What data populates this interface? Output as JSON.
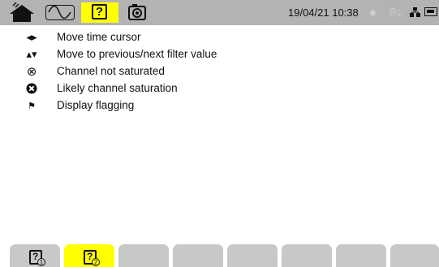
{
  "status_bar": {
    "datetime": "19/04/21 10:38",
    "icons": [
      "home-icon",
      "waveform-icon",
      "help-icon",
      "camera-icon",
      "recording-icon",
      "usb-icon",
      "network-icon",
      "battery-icon"
    ]
  },
  "legend": [
    {
      "icon": "left-right-arrows-icon",
      "symbol": "◂▸",
      "label": "Move time cursor"
    },
    {
      "icon": "up-down-arrows-icon",
      "symbol": "▴▾",
      "label": "Move to previous/next filter value"
    },
    {
      "icon": "circle-x-outline-icon",
      "symbol": "⊗",
      "label": "Channel not saturated"
    },
    {
      "icon": "circle-x-filled-icon",
      "symbol": "✖",
      "label": "Likely channel saturation"
    },
    {
      "icon": "flag-icon",
      "symbol": "⚑",
      "label": "Display flagging"
    }
  ],
  "tabs": [
    {
      "icon": "help-page-1-icon",
      "page": "1",
      "active": false
    },
    {
      "icon": "help-page-2-icon",
      "page": "2",
      "active": true
    },
    {
      "icon": "",
      "page": "",
      "active": false
    },
    {
      "icon": "",
      "page": "",
      "active": false
    },
    {
      "icon": "",
      "page": "",
      "active": false
    },
    {
      "icon": "",
      "page": "",
      "active": false
    },
    {
      "icon": "",
      "page": "",
      "active": false
    },
    {
      "icon": "",
      "page": "",
      "active": false
    }
  ],
  "colors": {
    "bar": "#b3b3b3",
    "active": "#ffff00",
    "tab": "#c8c8c8"
  }
}
